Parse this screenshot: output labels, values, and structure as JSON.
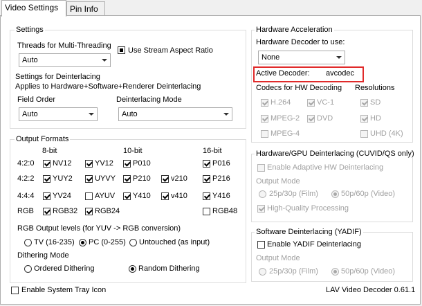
{
  "tabs": [
    "Video Settings",
    "Pin Info"
  ],
  "settings": {
    "title": "Settings",
    "threads_label": "Threads for Multi-Threading",
    "threads_value": "Auto",
    "aspect_label": "Use Stream Aspect Ratio",
    "deint_heading": "Settings for Deinterlacing",
    "deint_sub": "Applies to Hardware+Software+Renderer Deinterlacing",
    "field_order_label": "Field Order",
    "field_order_value": "Auto",
    "deint_mode_label": "Deinterlacing Mode",
    "deint_mode_value": "Auto"
  },
  "output": {
    "title": "Output Formats",
    "col_8bit": "8-bit",
    "col_10bit": "10-bit",
    "col_16bit": "16-bit",
    "row_420": "4:2:0",
    "row_422": "4:2:2",
    "row_444": "4:4:4",
    "row_rgb": "RGB",
    "fmt": {
      "nv12": "NV12",
      "yv12": "YV12",
      "p010": "P010",
      "p016": "P016",
      "yuy2": "YUY2",
      "uyvy": "UYVY",
      "p210": "P210",
      "v210": "v210",
      "p216": "P216",
      "yv24": "YV24",
      "ayuv": "AYUV",
      "y410": "Y410",
      "v410": "v410",
      "y416": "Y416",
      "rgb32": "RGB32",
      "rgb24": "RGB24",
      "rgb48": "RGB48"
    },
    "levels_label": "RGB Output levels (for YUV -> RGB conversion)",
    "levels_tv": "TV (16-235)",
    "levels_pc": "PC (0-255)",
    "levels_untouched": "Untouched (as input)",
    "dither_label": "Dithering Mode",
    "dither_ordered": "Ordered Dithering",
    "dither_random": "Random Dithering"
  },
  "hw": {
    "title": "Hardware Acceleration",
    "decoder_label": "Hardware Decoder to use:",
    "decoder_value": "None",
    "active_label": "Active Decoder:",
    "active_value": "avcodec",
    "codecs_label": "Codecs for HW Decoding",
    "res_label": "Resolutions",
    "h264": "H.264",
    "vc1": "VC-1",
    "mpeg2": "MPEG-2",
    "dvd": "DVD",
    "mpeg4": "MPEG-4",
    "sd": "SD",
    "hd": "HD",
    "uhd": "UHD (4K)"
  },
  "hwdeint": {
    "title": "Hardware/GPU Deinterlacing (CUVID/QS only)",
    "adaptive": "Enable Adaptive HW Deinterlacing",
    "output_mode": "Output Mode",
    "film": "25p/30p (Film)",
    "video": "50p/60p (Video)",
    "hq": "High-Quality Processing"
  },
  "swdeint": {
    "title": "Software Deinterlacing (YADIF)",
    "enable": "Enable YADIF Deinterlacing",
    "output_mode": "Output Mode",
    "film": "25p/30p (Film)",
    "video": "50p/60p (Video)"
  },
  "footer": {
    "tray": "Enable System Tray Icon",
    "version": "LAV Video Decoder 0.61.1"
  },
  "colors": {
    "highlight_box": "#e02a2a"
  }
}
